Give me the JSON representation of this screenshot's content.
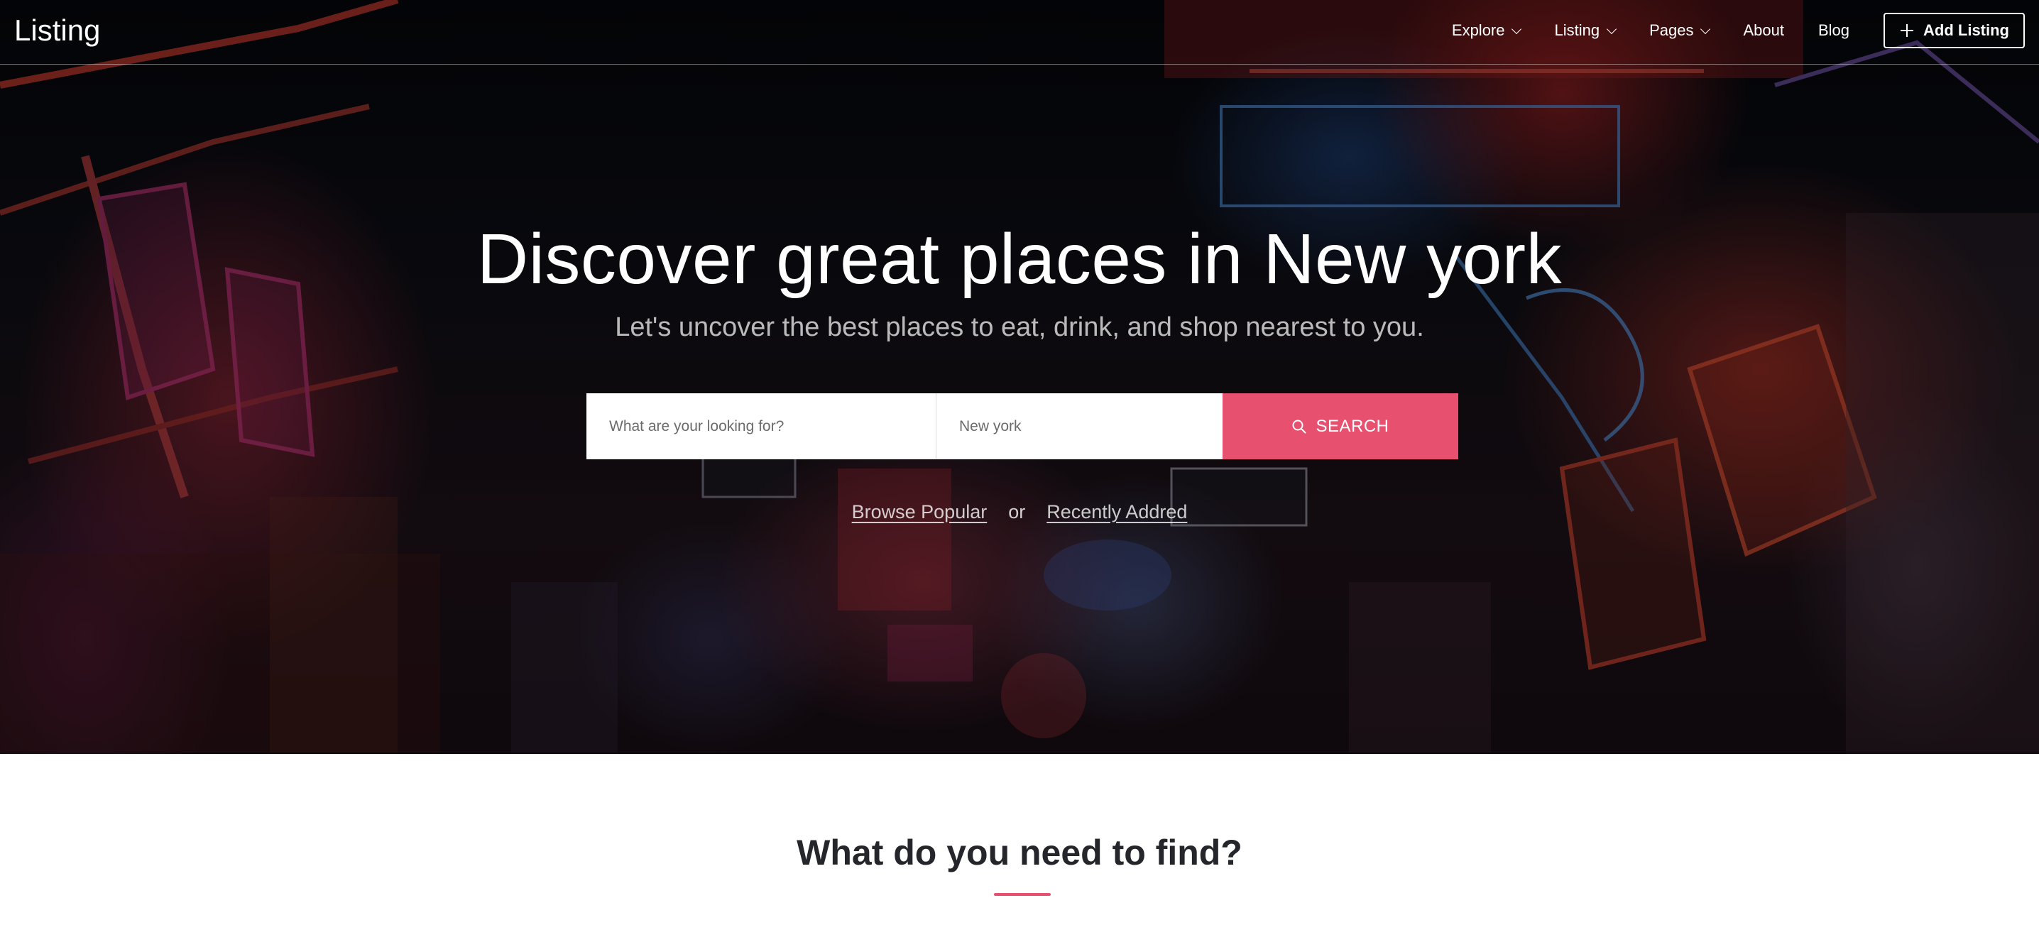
{
  "header": {
    "brand": "Listing",
    "nav": [
      {
        "label": "Explore",
        "has_dropdown": true
      },
      {
        "label": "Listing",
        "has_dropdown": true
      },
      {
        "label": "Pages",
        "has_dropdown": true
      },
      {
        "label": "About",
        "has_dropdown": false
      },
      {
        "label": "Blog",
        "has_dropdown": false
      }
    ],
    "add_listing_label": "Add Listing"
  },
  "hero": {
    "title": "Discover great places in New york",
    "subtitle": "Let's uncover the best places to eat, drink, and shop nearest to you.",
    "search": {
      "what_placeholder": "What are your looking for?",
      "where_value": "New york",
      "button_label": "SEARCH"
    },
    "links": {
      "browse_popular": "Browse Popular",
      "or": "or",
      "recently_added": "Recently Addred"
    }
  },
  "section": {
    "title": "What do you need to find?"
  },
  "colors": {
    "accent": "#e8506f",
    "heading": "#25262c"
  },
  "icons": [
    "chevron-down-icon",
    "plus-icon",
    "search-icon"
  ]
}
